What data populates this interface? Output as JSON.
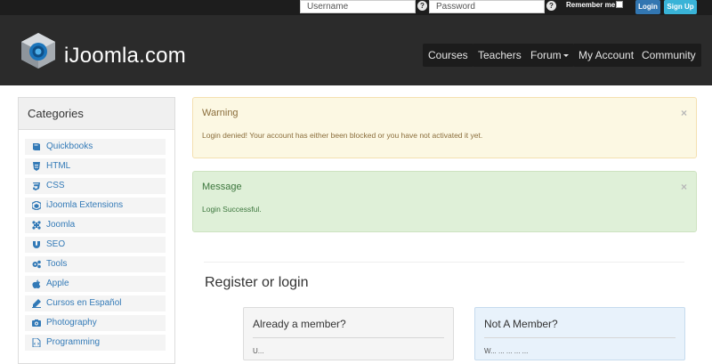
{
  "topbar": {
    "username_placeholder": "Username",
    "password_placeholder": "Password",
    "help_glyph": "?",
    "remember_label": "Remember me",
    "login_label": "Login",
    "signup_label": "Sign Up"
  },
  "header": {
    "site_name": "iJoomla.com",
    "nav": [
      "Courses",
      "Teachers",
      "Forum",
      "My Account",
      "Community"
    ]
  },
  "sidebar": {
    "title": "Categories",
    "items": [
      {
        "label": "Quickbooks",
        "icon": "book-icon"
      },
      {
        "label": "HTML",
        "icon": "html5-icon"
      },
      {
        "label": "CSS",
        "icon": "css3-icon"
      },
      {
        "label": "iJoomla Extensions",
        "icon": "cube-icon"
      },
      {
        "label": "Joomla",
        "icon": "joomla-icon"
      },
      {
        "label": "SEO",
        "icon": "magnet-icon"
      },
      {
        "label": "Tools",
        "icon": "gears-icon"
      },
      {
        "label": "Apple",
        "icon": "apple-icon"
      },
      {
        "label": "Cursos en Español",
        "icon": "pencil-icon"
      },
      {
        "label": "Photography",
        "icon": "camera-icon"
      },
      {
        "label": "Programming",
        "icon": "file-code-icon"
      }
    ]
  },
  "alerts": {
    "warning": {
      "title": "Warning",
      "text": "Login denied! Your account has either been blocked or you have not activated it yet.",
      "close": "×"
    },
    "success": {
      "title": "Message",
      "text": "Login Successful.",
      "close": "×"
    }
  },
  "register": {
    "title": "Register or login",
    "member_panel_title": "Already a member?",
    "member_panel_clip": "U...",
    "notmember_panel_title": "Not A Member?",
    "notmember_panel_clip": "W... ... ... ... ..."
  },
  "colors": {
    "topbar_bg": "#1d1d1d",
    "header_bg": "#2b2b2b",
    "login_button": "#3276b1",
    "signup_button": "#39b3d7",
    "link_blue": "#337ab7",
    "warning_bg": "#fcf8e3",
    "success_bg": "#dff0d8"
  }
}
